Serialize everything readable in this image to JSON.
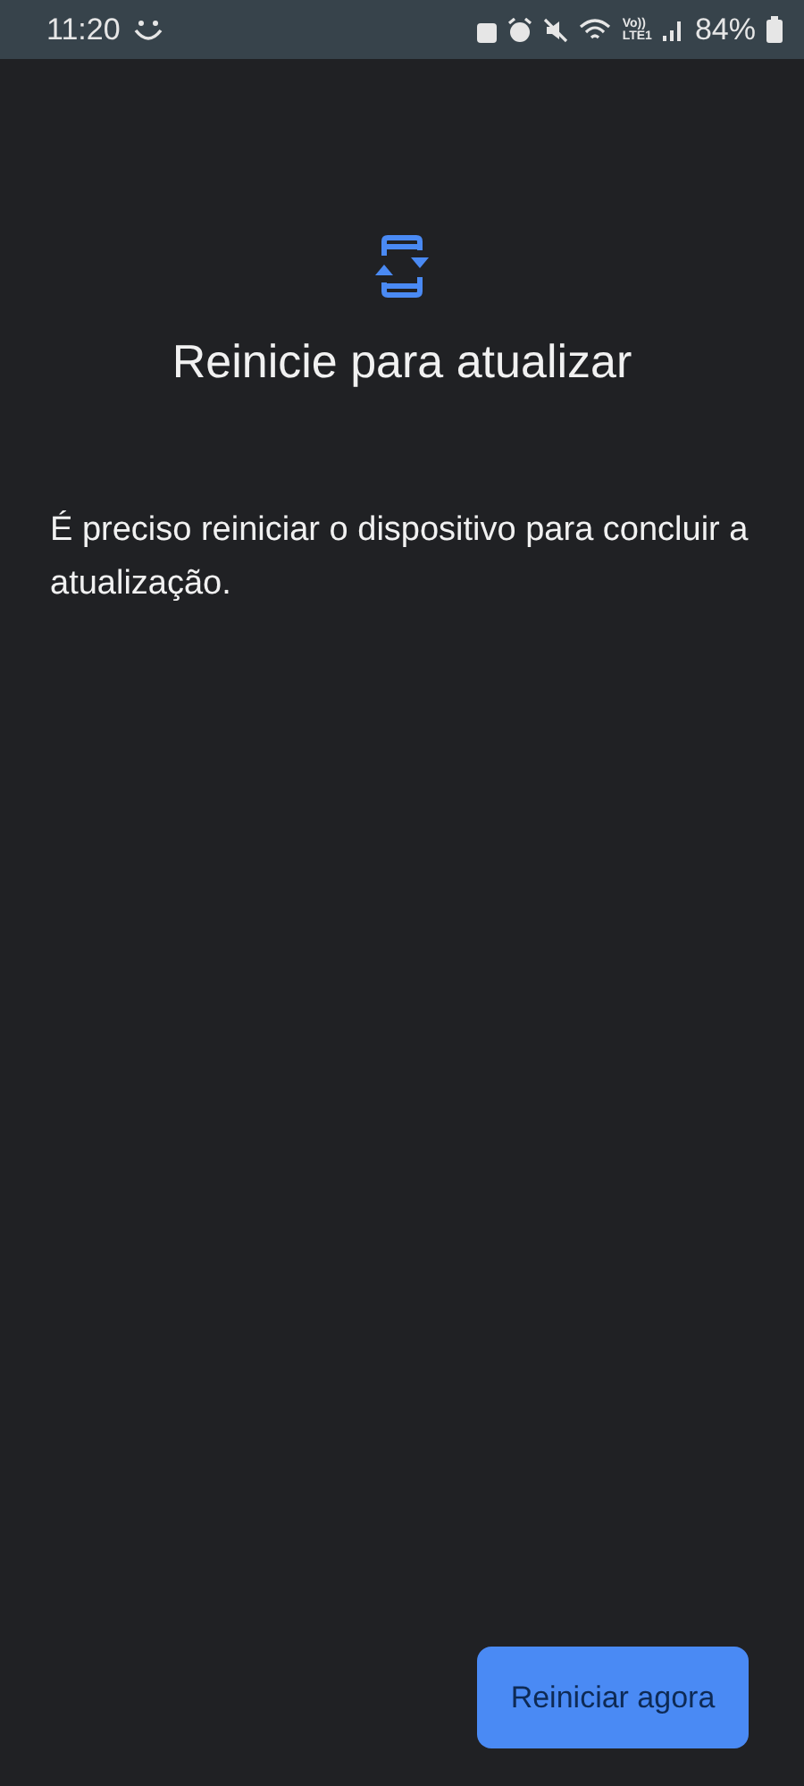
{
  "status_bar": {
    "time": "11:20",
    "volte_label": "Vo))",
    "lte_label": "LTE1",
    "battery": "84%"
  },
  "title": "Reinicie para atualizar",
  "message": "É preciso reiniciar o dispositivo para concluir a atualização.",
  "button": {
    "label": "Reiniciar agora"
  }
}
